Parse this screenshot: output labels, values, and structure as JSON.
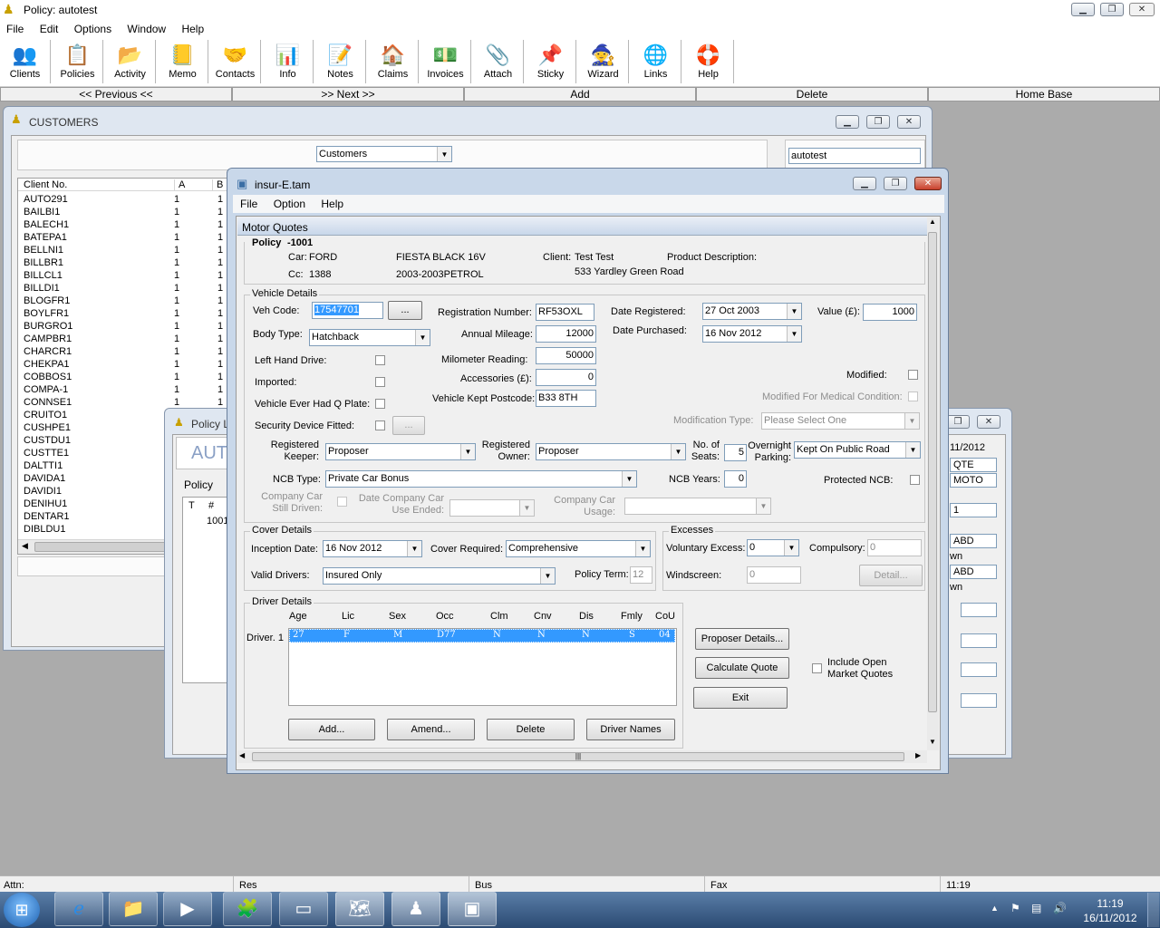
{
  "app": {
    "title": "Policy: autotest",
    "menu": [
      "File",
      "Edit",
      "Options",
      "Window",
      "Help"
    ]
  },
  "toolbar": [
    {
      "label": "Clients",
      "icon": "clients-icon",
      "glyph": "👥"
    },
    {
      "label": "Policies",
      "icon": "policies-icon",
      "glyph": "📋"
    },
    {
      "label": "Activity",
      "icon": "activity-icon",
      "glyph": "📂"
    },
    {
      "label": "Memo",
      "icon": "memo-icon",
      "glyph": "📒"
    },
    {
      "label": "Contacts",
      "icon": "contacts-icon",
      "glyph": "🤝"
    },
    {
      "label": "Info",
      "icon": "info-icon",
      "glyph": "📊"
    },
    {
      "label": "Notes",
      "icon": "notes-icon",
      "glyph": "📝"
    },
    {
      "label": "Claims",
      "icon": "claims-icon",
      "glyph": "🏠"
    },
    {
      "label": "Invoices",
      "icon": "invoices-icon",
      "glyph": "💵"
    },
    {
      "label": "Attach",
      "icon": "attach-icon",
      "glyph": "📎"
    },
    {
      "label": "Sticky",
      "icon": "sticky-icon",
      "glyph": "📌"
    },
    {
      "label": "Wizard",
      "icon": "wizard-icon",
      "glyph": "🧙"
    },
    {
      "label": "Links",
      "icon": "links-icon",
      "glyph": "🌐"
    },
    {
      "label": "Help",
      "icon": "help-icon",
      "glyph": "🛟"
    }
  ],
  "nav": {
    "previous": "<< Previous <<",
    "next": ">> Next >>",
    "add": "Add",
    "delete": "Delete",
    "home": "Home Base"
  },
  "customers": {
    "title": "CUSTOMERS",
    "dropdown": "Customers",
    "search": "autotest",
    "columns": [
      "Client No.",
      "A",
      "B"
    ],
    "rows": [
      [
        "AUTO291",
        "1",
        "1"
      ],
      [
        "BAILBI1",
        "1",
        "1"
      ],
      [
        "BALECH1",
        "1",
        "1"
      ],
      [
        "BATEPA1",
        "1",
        "1"
      ],
      [
        "BELLNI1",
        "1",
        "1"
      ],
      [
        "BILLBR1",
        "1",
        "1"
      ],
      [
        "BILLCL1",
        "1",
        "1"
      ],
      [
        "BILLDI1",
        "1",
        "1"
      ],
      [
        "BLOGFR1",
        "1",
        "1"
      ],
      [
        "BOYLFR1",
        "1",
        "1"
      ],
      [
        "BURGRO1",
        "1",
        "1"
      ],
      [
        "CAMPBR1",
        "1",
        "1"
      ],
      [
        "CHARCR1",
        "1",
        "1"
      ],
      [
        "CHEKPA1",
        "1",
        "1"
      ],
      [
        "COBBOS1",
        "1",
        "1"
      ],
      [
        "COMPA-1",
        "1",
        "1"
      ],
      [
        "CONNSE1",
        "1",
        "1"
      ],
      [
        "CRUITO1",
        "1",
        ""
      ],
      [
        "CUSHPE1",
        "1",
        ""
      ],
      [
        "CUSTDU1",
        "1",
        ""
      ],
      [
        "CUSTTE1",
        "1",
        ""
      ],
      [
        "DALTTI1",
        "1",
        ""
      ],
      [
        "DAVIDA1",
        "1",
        ""
      ],
      [
        "DAVIDI1",
        "1",
        ""
      ],
      [
        "DENIHU1",
        "1",
        ""
      ],
      [
        "DENTAR1",
        "1",
        ""
      ],
      [
        "DIBLDU1",
        "1",
        ""
      ]
    ]
  },
  "policy_bg": {
    "title": "Policy L",
    "aut": "AUT",
    "tab": "Policy",
    "col_t": "T",
    "col_hash": "#",
    "row_val": "1001",
    "right_values": [
      "11/2012",
      "QTE",
      "MOTO",
      "1",
      "ABD",
      "wn",
      "ABD",
      "wn"
    ]
  },
  "insure": {
    "title": "insur-E.tam",
    "menu": [
      "File",
      "Option",
      "Help"
    ],
    "header": "Motor Quotes",
    "policy_label": "Policy",
    "policy_no": "-1001",
    "car_label": "Car:",
    "car_make": "FORD",
    "car_model": "FIESTA BLACK 16V",
    "cc_label": "Cc:",
    "cc": "1388",
    "years": "2003-2003PETROL",
    "client_label": "Client:",
    "client": "Test Test",
    "address": "533 Yardley Green Road",
    "product_label": "Product Description:",
    "vehicle": {
      "group": "Vehicle Details",
      "veh_code_label": "Veh Code:",
      "veh_code": "17547701",
      "ellipsis": "...",
      "reg_label": "Registration Number:",
      "reg": "RF53OXL",
      "date_reg_label": "Date Registered:",
      "date_reg": "27 Oct 2003",
      "value_label": "Value (£):",
      "value": "1000",
      "body_label": "Body Type:",
      "body": "Hatchback",
      "mileage_label": "Annual Mileage:",
      "mileage": "12000",
      "date_purch_label": "Date Purchased:",
      "date_purch": "16 Nov 2012",
      "lhd_label": "Left Hand Drive:",
      "milo_label": "Milometer Reading:",
      "milo": "50000",
      "imported_label": "Imported:",
      "acc_label": "Accessories (£):",
      "acc": "0",
      "modified_label": "Modified:",
      "qplate_label": "Vehicle Ever Had Q Plate:",
      "postcode_label": "Vehicle Kept Postcode:",
      "postcode": "B33 8TH",
      "med_label": "Modified For Medical Condition:",
      "security_label": "Security Device Fitted:",
      "modtype_label": "Modification Type:",
      "modtype": "Please Select One",
      "reg_keeper_label": "Registered\nKeeper:",
      "reg_keeper": "Proposer",
      "reg_owner_label": "Registered\nOwner:",
      "reg_owner": "Proposer",
      "seats_label": "No. of\nSeats:",
      "seats": "5",
      "overnight_label": "Overnight\nParking:",
      "overnight": "Kept On Public Road",
      "ncb_type_label": "NCB Type:",
      "ncb_type": "Private Car Bonus",
      "ncb_years_label": "NCB Years:",
      "ncb_years": "0",
      "protected_label": "Protected NCB:",
      "cc_still_label": "Company Car\nStill Driven:",
      "cc_ended_label": "Date Company Car\nUse Ended:",
      "cc_usage_label": "Company Car\nUsage:"
    },
    "cover": {
      "group": "Cover Details",
      "inception_label": "Inception Date:",
      "inception": "16 Nov 2012",
      "cover_req_label": "Cover Required:",
      "cover_req": "Comprehensive",
      "valid_label": "Valid Drivers:",
      "valid": "Insured Only",
      "term_label": "Policy Term:",
      "term": "12"
    },
    "excesses": {
      "group": "Excesses",
      "voluntary_label": "Voluntary Excess:",
      "voluntary": "0",
      "compulsory_label": "Compulsory:",
      "compulsory": "0",
      "windscreen_label": "Windscreen:",
      "windscreen": "0",
      "detail": "Detail..."
    },
    "drivers": {
      "group": "Driver Details",
      "columns": [
        "Age",
        "Lic",
        "Sex",
        "Occ",
        "Clm",
        "Cnv",
        "Dis",
        "Fmly",
        "CoU"
      ],
      "row_label": "Driver. 1",
      "row": [
        "27",
        "F",
        "M",
        "D77",
        "N",
        "N",
        "N",
        "S",
        "04"
      ],
      "add": "Add...",
      "amend": "Amend...",
      "delete": "Delete",
      "names": "Driver Names"
    },
    "buttons": {
      "proposer": "Proposer Details...",
      "calc": "Calculate Quote",
      "exit": "Exit",
      "open_market": "Include Open\nMarket Quotes"
    }
  },
  "statusbar": {
    "attn": "Attn:",
    "res": "Res",
    "bus": "Bus",
    "fax": "Fax",
    "time": "11:19"
  },
  "taskbar": {
    "clock_time": "11:19",
    "clock_date": "16/11/2012"
  }
}
